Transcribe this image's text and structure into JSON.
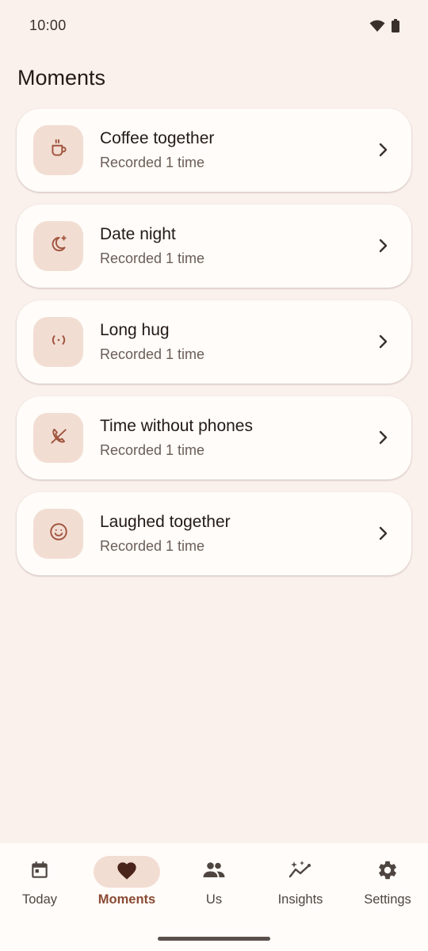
{
  "status_bar": {
    "time": "10:00",
    "icons": [
      "wifi-icon",
      "battery-icon"
    ]
  },
  "page": {
    "title": "Moments"
  },
  "moments": [
    {
      "icon": "coffee-cup-icon",
      "title": "Coffee together",
      "subtitle": "Recorded 1 time"
    },
    {
      "icon": "moon-star-icon",
      "title": "Date night",
      "subtitle": "Recorded 1 time"
    },
    {
      "icon": "hug-icon",
      "title": "Long hug",
      "subtitle": "Recorded 1 time"
    },
    {
      "icon": "phone-off-icon",
      "title": "Time without phones",
      "subtitle": "Recorded 1 time"
    },
    {
      "icon": "smiley-icon",
      "title": "Laughed together",
      "subtitle": "Recorded 1 time"
    }
  ],
  "nav": {
    "active": "Moments",
    "items": [
      {
        "label": "Today",
        "icon": "calendar-icon"
      },
      {
        "label": "Moments",
        "icon": "heart-icon"
      },
      {
        "label": "Us",
        "icon": "people-icon"
      },
      {
        "label": "Insights",
        "icon": "sparkle-chart-icon"
      },
      {
        "label": "Settings",
        "icon": "gear-icon"
      }
    ]
  },
  "colors": {
    "background": "#FBF1EC",
    "card": "#FFFCF9",
    "icon_container": "#F2DDD3",
    "accent": "#8A4A33",
    "icon_stroke": "#A0553E"
  }
}
